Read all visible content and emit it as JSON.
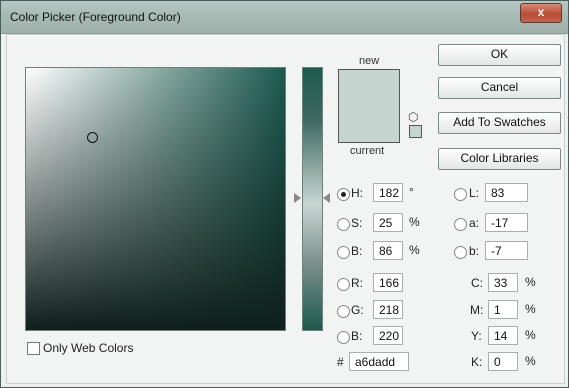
{
  "window": {
    "title": "Color Picker (Foreground Color)",
    "close_glyph": "x"
  },
  "preview": {
    "new_label": "new",
    "current_label": "current",
    "color": "#a6dadc"
  },
  "buttons": {
    "ok": "OK",
    "cancel": "Cancel",
    "add_to_swatches": "Add To Swatches",
    "color_libraries": "Color Libraries"
  },
  "fields": {
    "h": {
      "label": "H:",
      "value": "182",
      "unit": "°"
    },
    "s": {
      "label": "S:",
      "value": "25",
      "unit": "%"
    },
    "b": {
      "label": "B:",
      "value": "86",
      "unit": "%"
    },
    "r": {
      "label": "R:",
      "value": "166"
    },
    "g": {
      "label": "G:",
      "value": "218"
    },
    "bl": {
      "label": "B:",
      "value": "220"
    },
    "l": {
      "label": "L:",
      "value": "83"
    },
    "a": {
      "label": "a:",
      "value": "-17"
    },
    "b_lab": {
      "label": "b:",
      "value": "-7"
    },
    "c": {
      "label": "C:",
      "value": "33",
      "unit": "%"
    },
    "m": {
      "label": "M:",
      "value": "1",
      "unit": "%"
    },
    "y": {
      "label": "Y:",
      "value": "14",
      "unit": "%"
    },
    "k": {
      "label": "K:",
      "value": "0",
      "unit": "%"
    },
    "hex": {
      "label": "#",
      "value": "a6dadd"
    }
  },
  "only_web_colors": {
    "label": "Only Web Colors",
    "checked": false
  },
  "icons": {
    "cube": "cube-icon",
    "mini_swatch": "web-safe-swatch-icon"
  },
  "colors": {
    "titlebar": "#a7bbb5",
    "close": "#c7634c",
    "field_hue": "#1b5a4e"
  }
}
